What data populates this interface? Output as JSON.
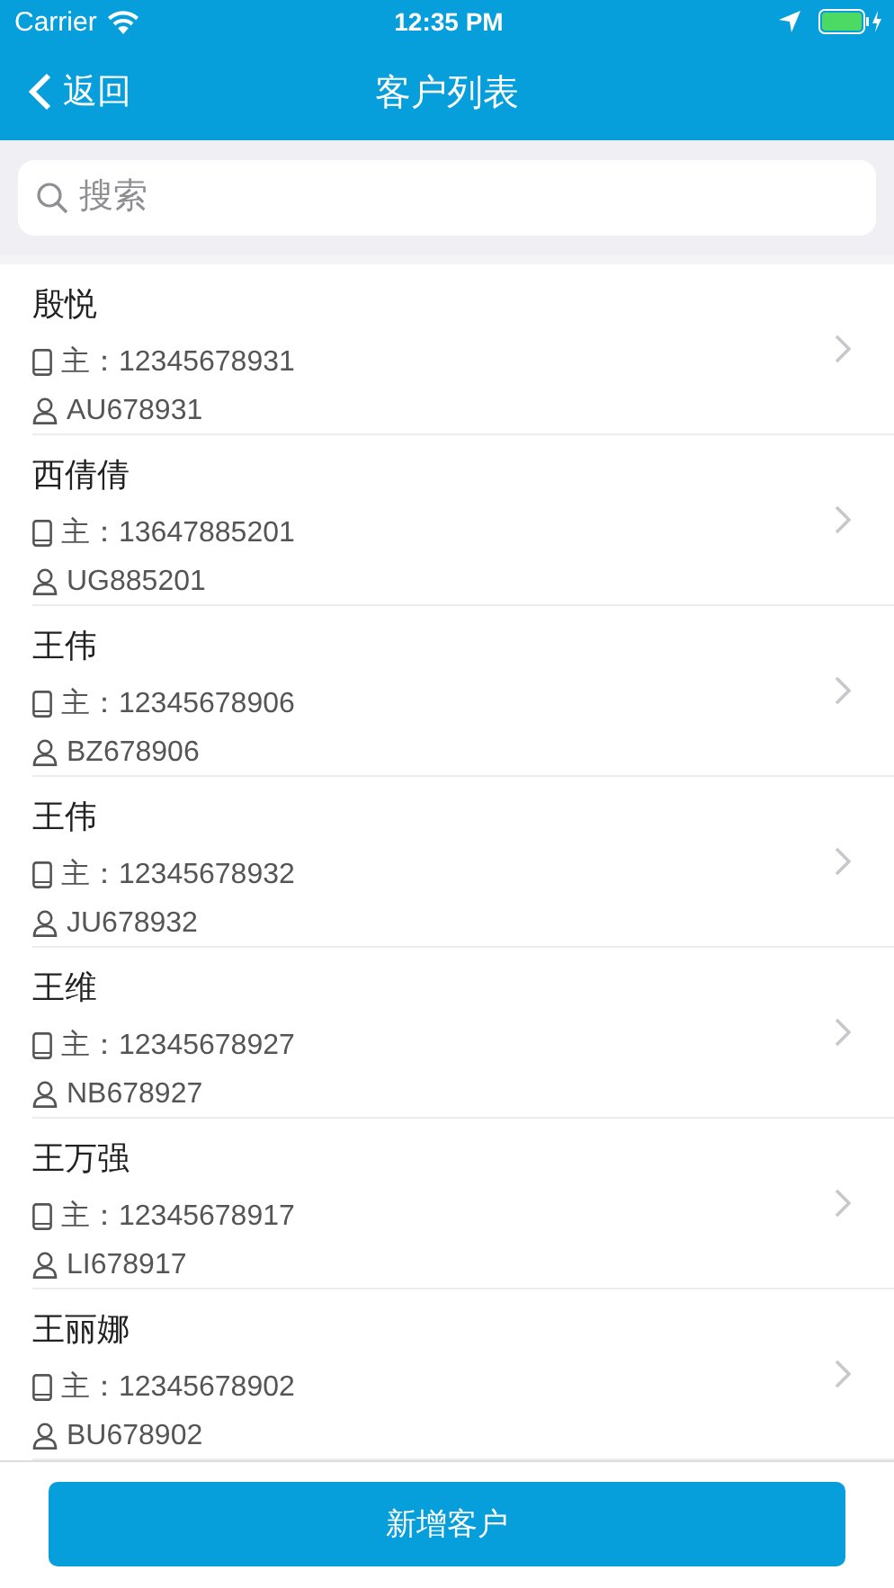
{
  "status_bar": {
    "carrier": "Carrier",
    "time": "12:35 PM"
  },
  "nav": {
    "back": "返回",
    "title": "客户列表"
  },
  "search": {
    "placeholder": "搜索"
  },
  "customers": [
    {
      "name": "殷悦",
      "phone_label": "主：",
      "phone": "12345678931",
      "account": "AU678931"
    },
    {
      "name": "西倩倩",
      "phone_label": "主：",
      "phone": "13647885201",
      "account": "UG885201"
    },
    {
      "name": "王伟",
      "phone_label": "主：",
      "phone": "12345678906",
      "account": "BZ678906"
    },
    {
      "name": "王伟",
      "phone_label": "主：",
      "phone": "12345678932",
      "account": "JU678932"
    },
    {
      "name": "王维",
      "phone_label": "主：",
      "phone": "12345678927",
      "account": "NB678927"
    },
    {
      "name": "王万强",
      "phone_label": "主：",
      "phone": "12345678917",
      "account": "LI678917"
    },
    {
      "name": "王丽娜",
      "phone_label": "主：",
      "phone": "12345678902",
      "account": "BU678902"
    }
  ],
  "add_button": "新增客户"
}
